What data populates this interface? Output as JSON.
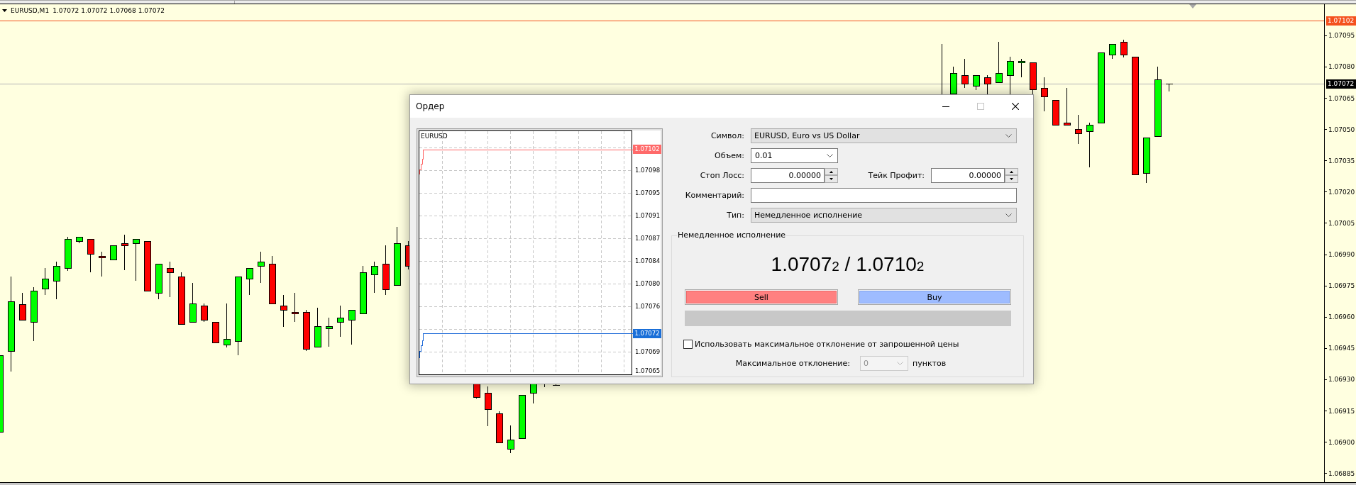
{
  "terminal_chart": {
    "legend": {
      "symbol": "EURUSD,M1",
      "prices": [
        "1.07072",
        "1.07072",
        "1.07068",
        "1.07072"
      ]
    },
    "price_axis": {
      "labels": [
        "1.07095",
        "1.07080",
        "1.07065",
        "1.07050",
        "1.07035",
        "1.07020",
        "1.07005",
        "1.06990",
        "1.06975",
        "1.06960",
        "1.06945",
        "1.06930",
        "1.06915",
        "1.06900",
        "1.06885"
      ],
      "ask_tag": "1.07102",
      "bid_tag": "1.07072"
    }
  },
  "order_dialog": {
    "title": "Ордер",
    "tick_chart": {
      "symbol": "EURUSD",
      "axis_labels": [
        "1.07098",
        "1.07095",
        "1.07091",
        "1.07087",
        "1.07084",
        "1.07080",
        "1.07076",
        "1.07069",
        "1.07065"
      ],
      "ask_tag": "1.07102",
      "bid_tag": "1.07072"
    },
    "symbol": {
      "label": "Символ:",
      "value": "EURUSD, Euro vs US Dollar"
    },
    "volume": {
      "label": "Объем:",
      "value": "0.01"
    },
    "stop_loss": {
      "label": "Стоп Лосс:",
      "value": "0.00000"
    },
    "take_profit": {
      "label": "Тейк Профит:",
      "value": "0.00000"
    },
    "comment": {
      "label": "Комментарий:"
    },
    "order_type": {
      "label": "Тип:",
      "value": "Немедленное исполнение"
    },
    "execution": {
      "title": "Немедленное исполнение",
      "quote": {
        "bid": "1.0707",
        "bid_last_digit": "2",
        "separator": "/",
        "ask": "1.0710",
        "ask_last_digit": "2"
      },
      "buttons": [
        {
          "kind": "sell",
          "label": "Sell"
        },
        {
          "kind": "buy",
          "label": "Buy"
        }
      ],
      "max_deviation_checkbox": {
        "label": "Использовать максимальное отклонение от запрошенной цены",
        "checked": false
      },
      "max_deviation": {
        "label": "Максимальное отклонение:",
        "value": "0",
        "disabled": true,
        "unit": "пунктов"
      }
    }
  }
}
